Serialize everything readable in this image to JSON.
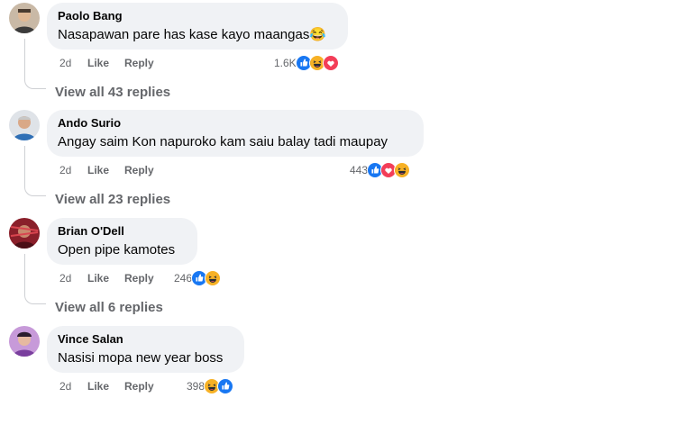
{
  "comments": [
    {
      "author": "Paolo Bang",
      "text": "Nasapawan pare has kase kayo maangas",
      "time": "2d",
      "like_label": "Like",
      "reply_label": "Reply",
      "reaction_count": "1.6K",
      "reactions": [
        "like",
        "haha",
        "love"
      ],
      "view_replies": "View all 43 replies"
    },
    {
      "author": "Ando Surio",
      "text": "Angay saim Kon napuroko kam saiu balay tadi maupay",
      "time": "2d",
      "like_label": "Like",
      "reply_label": "Reply",
      "reaction_count": "443",
      "reactions": [
        "like",
        "love",
        "haha"
      ],
      "view_replies": "View all 23 replies"
    },
    {
      "author": "Brian O'Dell",
      "text": "Open pipe kamotes",
      "time": "2d",
      "like_label": "Like",
      "reply_label": "Reply",
      "reaction_count": "246",
      "reactions": [
        "like",
        "haha"
      ],
      "view_replies": "View all 6 replies"
    },
    {
      "author": "Vince Salan",
      "text": "Nasisi mopa new year boss",
      "time": "2d",
      "like_label": "Like",
      "reply_label": "Reply",
      "reaction_count": "398",
      "reactions": [
        "haha",
        "like"
      ],
      "view_replies": ""
    }
  ],
  "colors": {
    "bubble": "#f0f2f5",
    "secondary_text": "#65676b",
    "like": "#1877f2",
    "love": "#f33e58",
    "haha": "#f7b125"
  }
}
